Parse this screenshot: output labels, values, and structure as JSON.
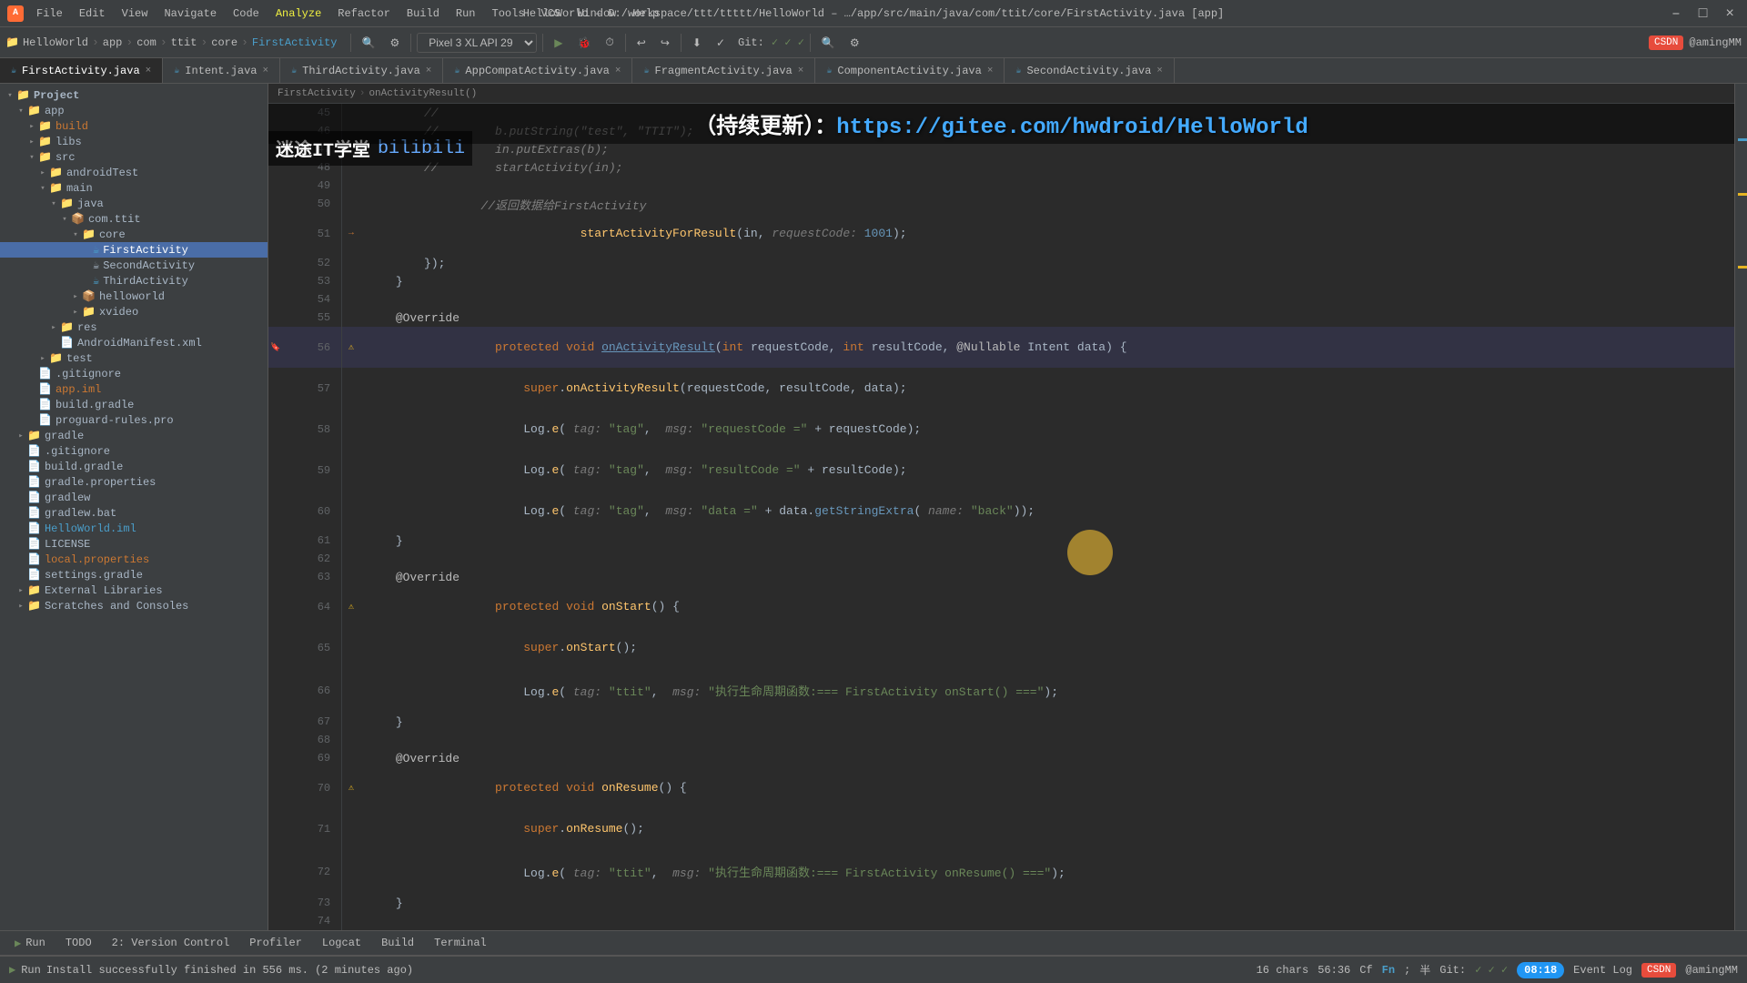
{
  "titleBar": {
    "appIcon": "A",
    "menuItems": [
      "File",
      "Edit",
      "View",
      "Navigate",
      "Code",
      "Analyze",
      "Refactor",
      "Build",
      "Run",
      "Tools",
      "VCS",
      "Window",
      "Help"
    ],
    "titleText": "HelloWorld – D:/workspace/ttt/ttttt/HelloWorld – …/app/src/main/java/com/ttit/core/FirstActivity.java [app]",
    "controls": [
      "–",
      "□",
      "×"
    ]
  },
  "toolbar": {
    "projectName": "HelloWorld",
    "pathParts": [
      "app",
      "com",
      "ttit",
      "core",
      "FirstActivity"
    ],
    "deviceSelector": "Pixel 3 XL API 29",
    "branchName": "app",
    "gitLabel": "Git:"
  },
  "tabs": [
    {
      "label": "FirstActivity.java",
      "active": true,
      "modified": false
    },
    {
      "label": "Intent.java",
      "active": false
    },
    {
      "label": "ThirdActivity.java",
      "active": false
    },
    {
      "label": "AppCompatActivity.java",
      "active": false
    },
    {
      "label": "FragmentActivity.java",
      "active": false
    },
    {
      "label": "ComponentActivity.java",
      "active": false
    },
    {
      "label": "SecondActivity.java",
      "active": false
    }
  ],
  "breadcrumb": {
    "items": [
      "FirstActivity",
      "onActivityResult()"
    ]
  },
  "sidebar": {
    "items": [
      {
        "label": "Project",
        "type": "header",
        "indent": 0
      },
      {
        "label": "app",
        "type": "folder",
        "indent": 1,
        "expanded": true
      },
      {
        "label": "build",
        "type": "folder",
        "indent": 2,
        "expanded": false,
        "color": "orange"
      },
      {
        "label": "libs",
        "type": "folder",
        "indent": 2,
        "expanded": false
      },
      {
        "label": "src",
        "type": "folder",
        "indent": 2,
        "expanded": true
      },
      {
        "label": "androidTest",
        "type": "folder",
        "indent": 3,
        "expanded": false
      },
      {
        "label": "main",
        "type": "folder",
        "indent": 3,
        "expanded": true
      },
      {
        "label": "java",
        "type": "folder",
        "indent": 4,
        "expanded": true
      },
      {
        "label": "com.ttit",
        "type": "folder",
        "indent": 5,
        "expanded": true
      },
      {
        "label": "core",
        "type": "folder",
        "indent": 6,
        "expanded": true
      },
      {
        "label": "FirstActivity",
        "type": "javafile",
        "indent": 7,
        "selected": true,
        "color": "blue"
      },
      {
        "label": "SecondActivity",
        "type": "javafile",
        "indent": 7,
        "color": "default"
      },
      {
        "label": "ThirdActivity",
        "type": "javafile",
        "indent": 7,
        "color": "blue"
      },
      {
        "label": "helloworld",
        "type": "folder",
        "indent": 5,
        "expanded": false
      },
      {
        "label": "xvideo",
        "type": "folder",
        "indent": 5,
        "expanded": false
      },
      {
        "label": "res",
        "type": "folder",
        "indent": 4,
        "expanded": false
      },
      {
        "label": "AndroidManifest.xml",
        "type": "xmlfile",
        "indent": 4
      },
      {
        "label": "test",
        "type": "folder",
        "indent": 3,
        "expanded": false
      },
      {
        "label": ".gitignore",
        "type": "file",
        "indent": 2
      },
      {
        "label": "app.iml",
        "type": "file",
        "indent": 2,
        "color": "orange"
      },
      {
        "label": "build.gradle",
        "type": "file",
        "indent": 2
      },
      {
        "label": "proguard-rules.pro",
        "type": "file",
        "indent": 2
      },
      {
        "label": "gradle",
        "type": "folder",
        "indent": 1,
        "expanded": false
      },
      {
        "label": ".gitignore",
        "type": "file",
        "indent": 1
      },
      {
        "label": "build.gradle",
        "type": "file",
        "indent": 1
      },
      {
        "label": "gradle.properties",
        "type": "file",
        "indent": 1
      },
      {
        "label": "gradlew",
        "type": "file",
        "indent": 1
      },
      {
        "label": "gradlew.bat",
        "type": "file",
        "indent": 1
      },
      {
        "label": "HelloWorld.iml",
        "type": "file",
        "indent": 1,
        "color": "blue"
      },
      {
        "label": "LICENSE",
        "type": "file",
        "indent": 1
      },
      {
        "label": "local.properties",
        "type": "file",
        "indent": 1,
        "color": "orange"
      },
      {
        "label": "settings.gradle",
        "type": "file",
        "indent": 1
      },
      {
        "label": "External Libraries",
        "type": "folder",
        "indent": 1,
        "expanded": false
      },
      {
        "label": "Scratches and Consoles",
        "type": "folder",
        "indent": 1,
        "expanded": false
      }
    ]
  },
  "codeLines": [
    {
      "num": 45,
      "content": "        //",
      "gutter": ""
    },
    {
      "num": 46,
      "content": "        //        b.putString(\"test\", \"TTIT\");",
      "gutter": ""
    },
    {
      "num": 47,
      "content": "        //        in.putExtras(b);",
      "gutter": ""
    },
    {
      "num": 48,
      "content": "        //        startActivity(in);",
      "gutter": ""
    },
    {
      "num": 49,
      "content": "",
      "gutter": ""
    },
    {
      "num": 50,
      "content": "                //返回数据给FirstActivity",
      "gutter": ""
    },
    {
      "num": 51,
      "content": "                startActivityForResult(in,  requestCode: 1001);",
      "gutter": "arrow"
    },
    {
      "num": 52,
      "content": "            });",
      "gutter": ""
    },
    {
      "num": 53,
      "content": "        }",
      "gutter": ""
    },
    {
      "num": 54,
      "content": "",
      "gutter": ""
    },
    {
      "num": 55,
      "content": "    @Override",
      "gutter": ""
    },
    {
      "num": 56,
      "content": "    protected void onActivityResult(int requestCode, int resultCode, @Nullable Intent data) {",
      "gutter": "warn"
    },
    {
      "num": 57,
      "content": "        super.onActivityResult(requestCode, resultCode, data);",
      "gutter": ""
    },
    {
      "num": 58,
      "content": "        Log.e( tag: \"tag\",  msg: \"requestCode =\" + requestCode);",
      "gutter": ""
    },
    {
      "num": 59,
      "content": "        Log.e( tag: \"tag\",  msg: \"resultCode =\" + resultCode);",
      "gutter": ""
    },
    {
      "num": 60,
      "content": "        Log.e( tag: \"tag\",  msg: \"data =\" + data.getStringExtra( name: \"back\"));",
      "gutter": ""
    },
    {
      "num": 61,
      "content": "    }",
      "gutter": ""
    },
    {
      "num": 62,
      "content": "",
      "gutter": ""
    },
    {
      "num": 63,
      "content": "    @Override",
      "gutter": ""
    },
    {
      "num": 64,
      "content": "    protected void onStart() {",
      "gutter": "warn"
    },
    {
      "num": 65,
      "content": "        super.onStart();",
      "gutter": ""
    },
    {
      "num": 66,
      "content": "        Log.e( tag: \"ttit\",  msg: \"执行生命周期函数:=== FirstActivity onStart() ===\");",
      "gutter": ""
    },
    {
      "num": 67,
      "content": "    }",
      "gutter": ""
    },
    {
      "num": 68,
      "content": "",
      "gutter": ""
    },
    {
      "num": 69,
      "content": "    @Override",
      "gutter": ""
    },
    {
      "num": 70,
      "content": "    protected void onResume() {",
      "gutter": "warn"
    },
    {
      "num": 71,
      "content": "        super.onResume();",
      "gutter": ""
    },
    {
      "num": 72,
      "content": "        Log.e( tag: \"ttit\",  msg: \"执行生命周期函数:=== FirstActivity onResume() ===\");",
      "gutter": ""
    },
    {
      "num": 73,
      "content": "    }",
      "gutter": ""
    },
    {
      "num": 74,
      "content": "",
      "gutter": ""
    }
  ],
  "bottomTabs": [
    {
      "label": "Run",
      "icon": "▶",
      "active": false
    },
    {
      "label": "TODO",
      "icon": "",
      "active": false
    },
    {
      "label": "Version Control",
      "icon": "2",
      "active": false,
      "badge": "2"
    },
    {
      "label": "Profiler",
      "icon": "",
      "active": false
    },
    {
      "label": "Logcat",
      "icon": "",
      "active": false
    },
    {
      "label": "Build",
      "icon": "",
      "active": false
    },
    {
      "label": "Terminal",
      "icon": "",
      "active": false
    }
  ],
  "statusBar": {
    "message": "Install successfully finished in 556 ms. (2 minutes ago)",
    "charCount": "16 chars",
    "position": "56:36",
    "encoding": "Cf",
    "fontLabel": "Fn",
    "inputMode": "半",
    "gitBranch": "Git:",
    "gitStatus": "✓ ✓ ✓",
    "timeBadge": "08:18",
    "eventLog": "Event Log",
    "csdnUser": "@amingMM"
  },
  "overlay": {
    "bannerText": "（持续更新）：",
    "bannerUrl": "https://gitee.com/hwdroid/HelloWorld",
    "logoText": "迷途IT学堂",
    "logoBrand": "bilibili"
  },
  "cursor": {
    "visible": true
  }
}
